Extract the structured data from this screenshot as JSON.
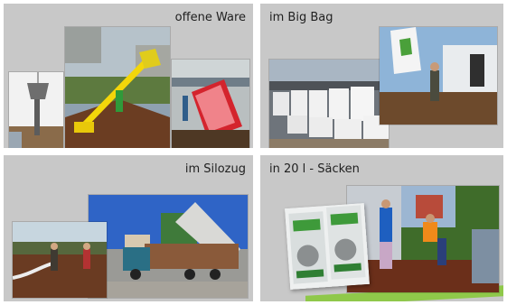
{
  "panels": [
    {
      "title": "offene Ware"
    },
    {
      "title": "im Big Bag"
    },
    {
      "title": "im Silozug"
    },
    {
      "title": "in 20 l - Säcken"
    }
  ]
}
